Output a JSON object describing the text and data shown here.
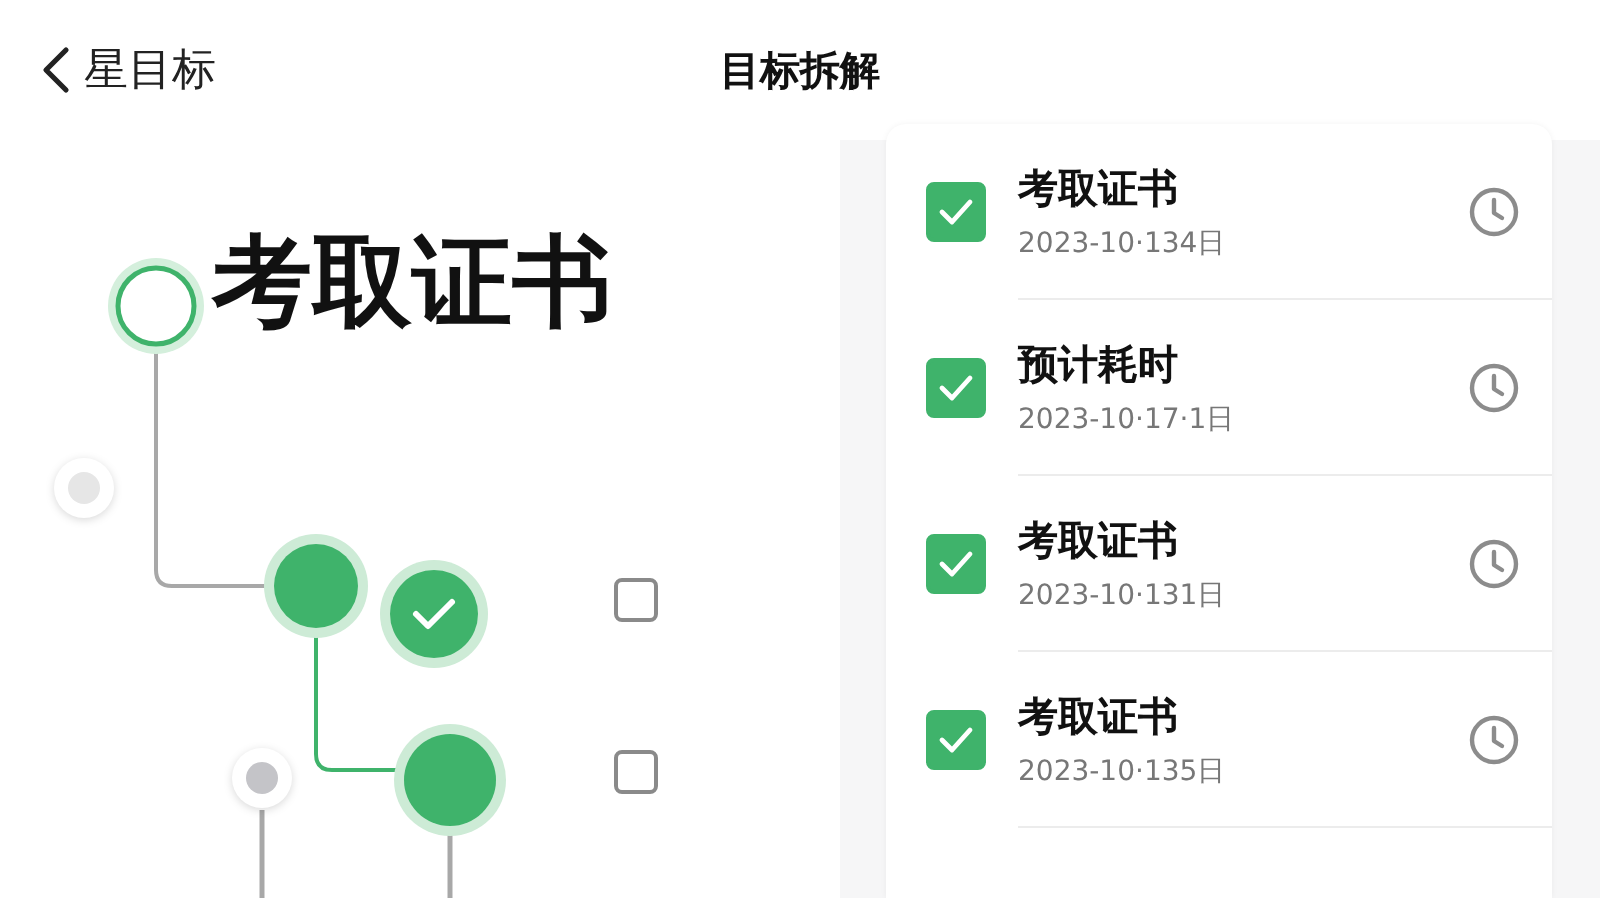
{
  "header": {
    "back_label": "星目标",
    "title": "目标拆解"
  },
  "goal_map": {
    "title": "考取证书",
    "nodes": [
      {
        "kind": "hollow"
      },
      {
        "kind": "dot"
      },
      {
        "kind": "filled"
      },
      {
        "kind": "done"
      },
      {
        "kind": "dot"
      },
      {
        "kind": "filled"
      }
    ],
    "checkboxes": [
      {
        "checked": false
      },
      {
        "checked": false
      }
    ]
  },
  "tasks": [
    {
      "title": "考取证书",
      "date": "2023-10·134日",
      "checked": true
    },
    {
      "title": "预计耗时",
      "date": "2023-10·17·1日",
      "checked": true
    },
    {
      "title": "考取证书",
      "date": "2023-10·131日",
      "checked": true
    },
    {
      "title": "考取证书",
      "date": "2023-10·135日",
      "checked": true
    }
  ]
}
